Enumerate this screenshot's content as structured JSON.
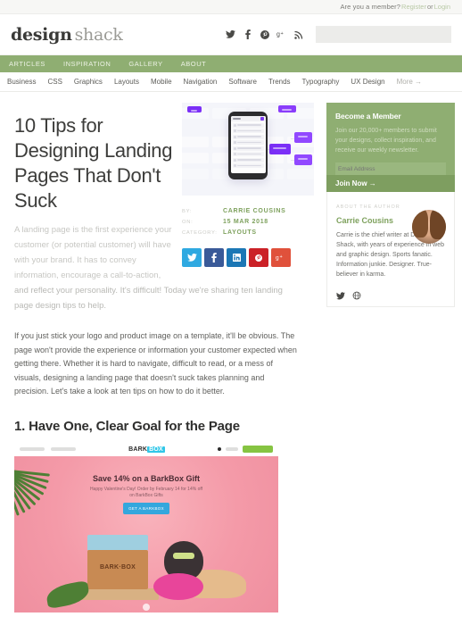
{
  "topbar": {
    "prompt": "Are you a member?",
    "register": "Register",
    "or": "or",
    "login": "Login"
  },
  "header": {
    "logo_primary": "design",
    "logo_secondary": "shack",
    "social_icons": [
      "twitter-icon",
      "facebook-icon",
      "pinterest-icon",
      "googleplus-icon",
      "rss-icon"
    ],
    "search_placeholder": ""
  },
  "nav": {
    "primary": [
      {
        "label": "ARTICLES",
        "active": true
      },
      {
        "label": "INSPIRATION",
        "active": false
      },
      {
        "label": "GALLERY",
        "active": false
      },
      {
        "label": "ABOUT",
        "active": false
      }
    ],
    "secondary": [
      "Business",
      "CSS",
      "Graphics",
      "Layouts",
      "Mobile",
      "Navigation",
      "Software",
      "Trends",
      "Typography",
      "UX Design"
    ],
    "more_label": "More →"
  },
  "article": {
    "title": "10 Tips for Designing Landing Pages That Don't Suck",
    "lede_narrow": "A landing page is the first experience your customer (or potential customer) will have with your brand. It has to convey information, encourage a call-to-action,",
    "lede_wide": "and reflect your personality. It's difficult! Today we're sharing ten landing page design tips to help.",
    "body": "If you just stick your logo and product image on a template, it'll be obvious. The page won't provide the experience or information your customer expected when getting there. Whether it is hard to navigate, difficult to read, or a mess of visuals, designing a landing page that doesn't suck takes planning and precision. Let's take a look at ten tips on how to do it better.",
    "subhead": "1. Have One, Clear Goal for the Page",
    "meta": [
      {
        "key": "BY:",
        "value": "CARRIE COUSINS"
      },
      {
        "key": "ON:",
        "value": "15 MAR 2018"
      },
      {
        "key": "CATEGORY:",
        "value": "LAYOUTS"
      }
    ],
    "share_buttons": [
      {
        "name": "twitter-share-button",
        "color": "#2fa9e1"
      },
      {
        "name": "facebook-share-button",
        "color": "#3a5a98"
      },
      {
        "name": "linkedin-share-button",
        "color": "#1b77b5"
      },
      {
        "name": "pinterest-share-button",
        "color": "#cb2127"
      },
      {
        "name": "googleplus-share-button",
        "color": "#e0513b"
      }
    ]
  },
  "figure": {
    "nav_logo_a": "BARK",
    "nav_logo_b": "BOX",
    "headline": "Save 14% on a BarkBox Gift",
    "subtext": "Happy Valentine's Day! Order by February 14 for 14% off on BarkBox Gifts",
    "button_label": "GET A BARKBOX",
    "box_label": "BARK·BOX"
  },
  "sidebar": {
    "member": {
      "title": "Become a Member",
      "copy": "Join our 20,000+ members to submit your designs, collect inspiration, and receive our weekly newsletter.",
      "email_placeholder": "Email Address",
      "cta_label": "Join Now →"
    },
    "author": {
      "kicker": "ABOUT THE AUTHOR",
      "name": "Carrie Cousins",
      "bio": "Carrie is the chief writer at Design Shack, with years of experience in web and graphic design. Sports fanatic. Information junkie. Designer. True-believer in karma.",
      "social_icons": [
        "twitter-icon",
        "globe-icon"
      ]
    }
  },
  "colors": {
    "brand_green": "#8fae72",
    "accent_green": "#7ea15d",
    "text_dark": "#3d3d3b"
  }
}
